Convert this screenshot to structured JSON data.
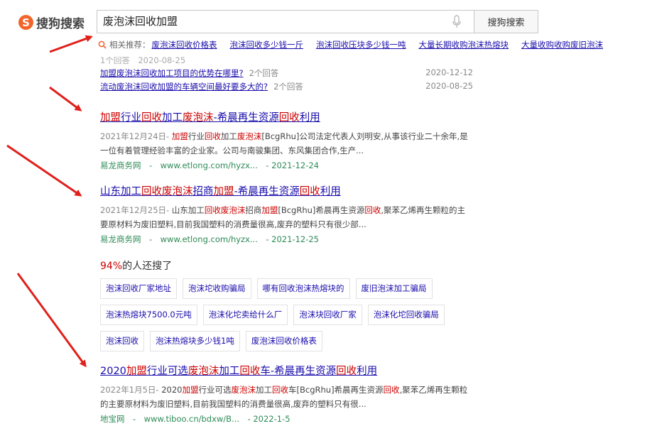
{
  "header": {
    "logo_mark": "S",
    "logo_text": "搜狗搜索",
    "query": "废泡沫回收加盟",
    "search_button": "搜狗搜索"
  },
  "related": {
    "label": "相关推荐：",
    "links": [
      "废泡沫回收价格表",
      "泡沫回收多少钱一斤",
      "泡沫回收压块多少钱一吨",
      "大量长期收购泡沫热熔块",
      "大量收购收购废旧泡沫"
    ]
  },
  "qa_faded": "1个回答　2020-08-25",
  "qa": [
    {
      "title": "加盟废泡沫回收加工项目的优势在哪里?",
      "answers": "2个回答",
      "date": "2020-12-12"
    },
    {
      "title": "流动废泡沫回收加盟的车辆空间最好要多大的?",
      "answers": "2个回答",
      "date": "2020-08-25"
    }
  ],
  "results": [
    {
      "title_parts": [
        [
          "加盟",
          true
        ],
        [
          "行业",
          false
        ],
        [
          "回收",
          true
        ],
        [
          "加工",
          false
        ],
        [
          "废泡沫",
          true
        ],
        [
          "-希晨再生资源",
          false
        ],
        [
          "回收",
          true
        ],
        [
          "利用",
          false
        ]
      ],
      "date": "2021年12月24日-",
      "desc_parts": [
        [
          " ",
          false
        ],
        [
          "加盟",
          true
        ],
        [
          "行业",
          false
        ],
        [
          "回收",
          true
        ],
        [
          "加工",
          false
        ],
        [
          "废泡沫",
          true
        ],
        [
          "[BcgRhu]公司法定代表人刘明安,从事该行业二十余年,是一位有着管理经验丰富的企业家。公司与南骏集团、东风集团合作,生产...",
          false
        ]
      ],
      "cite": "易龙商务网　-　www.etlong.com/hyzx...　- 2021-12-24"
    },
    {
      "title_parts": [
        [
          "山东加工",
          false
        ],
        [
          "回收",
          true
        ],
        [
          "废泡沫",
          true
        ],
        [
          "招商",
          false
        ],
        [
          "加盟",
          true
        ],
        [
          "-希晨再生资源",
          false
        ],
        [
          "回收",
          true
        ],
        [
          "利用",
          false
        ]
      ],
      "date": "2021年12月25日-",
      "desc_parts": [
        [
          " 山东加工",
          false
        ],
        [
          "回收废泡沫",
          true
        ],
        [
          "招商",
          false
        ],
        [
          "加盟",
          true
        ],
        [
          "[BcgRhu]希晨再生资源",
          false
        ],
        [
          "回收",
          true
        ],
        [
          ",聚苯乙烯再生颗粒的主要原材料为废旧塑料,目前我国塑料的消费量很高,废弃的塑料只有很少部...",
          false
        ]
      ],
      "cite": "易龙商务网　-　www.etlong.com/hyzx...　- 2021-12-25"
    },
    {
      "title_parts": [
        [
          "2020",
          false
        ],
        [
          "加盟",
          true
        ],
        [
          "行业可选",
          false
        ],
        [
          "废泡沫",
          true
        ],
        [
          "加工",
          false
        ],
        [
          "回收",
          true
        ],
        [
          "车-希晨再生资源",
          false
        ],
        [
          "回收",
          true
        ],
        [
          "利用",
          false
        ]
      ],
      "date": "2022年1月5日-",
      "desc_parts": [
        [
          " 2020",
          false
        ],
        [
          "加盟",
          true
        ],
        [
          "行业可选",
          false
        ],
        [
          "废泡沫",
          true
        ],
        [
          "加工",
          false
        ],
        [
          "回收",
          true
        ],
        [
          "车[BcgRhu]希晨再生资源",
          false
        ],
        [
          "回收",
          true
        ],
        [
          ",聚苯乙烯再生颗粒的主要原材料为废旧塑料,目前我国塑料的消费量很高,废弃的塑料只有很...",
          false
        ]
      ],
      "cite": "地宝网　-　www.tiboo.cn/bdxw/B...　- 2022-1-5"
    }
  ],
  "also_searched": {
    "percent": "94%",
    "label": "的人还搜了",
    "rows": [
      [
        "泡沫回收厂家地址",
        "泡沫坨收购骗局",
        "哪有回收泡沫热熔块的",
        "废旧泡沫加工骗局"
      ],
      [
        "泡沫热熔块7500.0元吨",
        "泡沫化坨卖给什么厂",
        "泡沫块回收厂家",
        "泡沫化坨回收骗局"
      ],
      [
        "泡沫回收",
        "泡沫热熔块多少钱1吨",
        "废泡沫回收价格表"
      ]
    ]
  },
  "colors": {
    "accent_red": "#cc0000",
    "link_blue": "#1a0dab",
    "cite_green": "#2e8b57",
    "logo_orange": "#f2642b",
    "arrow_red": "#e0201b"
  }
}
